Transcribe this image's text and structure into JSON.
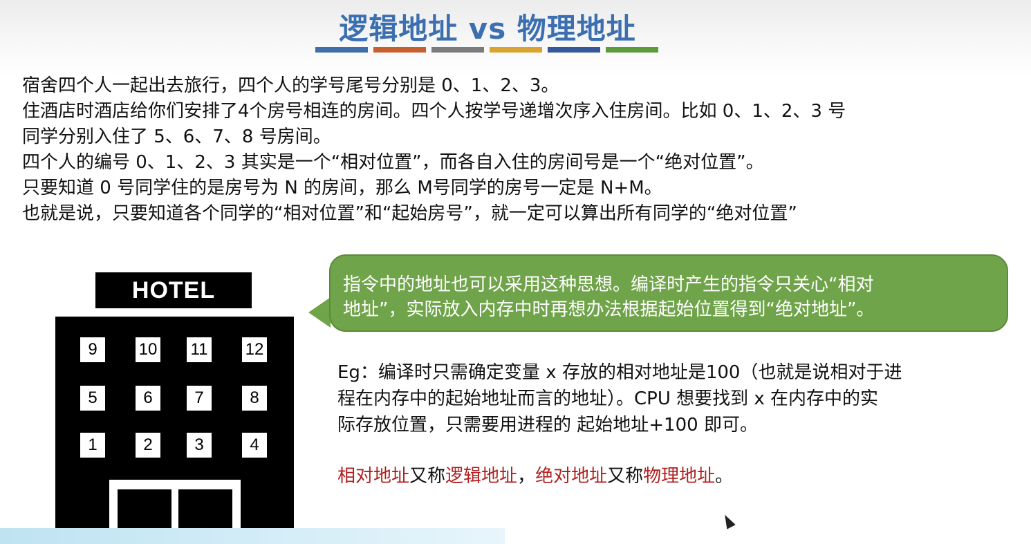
{
  "slide": {
    "title": "逻辑地址 vs 物理地址",
    "stripe_colors": [
      "#3f6fa8",
      "#c6602f",
      "#7b7b7b",
      "#d9a330",
      "#34589a",
      "#5c9a3c"
    ],
    "paragraph_lines": [
      "宿舍四个人一起出去旅行，四个人的学号尾号分别是 0、1、2、3。",
      "住酒店时酒店给你们安排了4个房号相连的房间。四个人按学号递增次序入住房间。比如 0、1、2、3 号",
      "同学分别入住了 5、6、7、8 号房间。",
      "四个人的编号 0、1、2、3 其实是一个“相对位置”，而各自入住的房间号是一个“绝对位置”。",
      "只要知道 0 号同学住的是房号为 N 的房间，那么 M号同学的房号一定是 N+M。",
      "也就是说，只要知道各个同学的“相对位置”和“起始房号”，就一定可以算出所有同学的“绝对位置”"
    ],
    "hotel": {
      "sign": "HOTEL",
      "rooms_row1": [
        "9",
        "10",
        "11",
        "12"
      ],
      "rooms_row2": [
        "5",
        "6",
        "7",
        "8"
      ],
      "rooms_row3": [
        "1",
        "2",
        "3",
        "4"
      ]
    },
    "bubble_lines": [
      "指令中的地址也可以采用这种思想。编译时产生的指令只关心“相对",
      "地址”，实际放入内存中时再想办法根据起始位置得到“绝对地址”。"
    ],
    "eg_lines": [
      "Eg：编译时只需确定变量 x 存放的相对地址是100（也就是说相对于进",
      "程在内存中的起始地址而言的地址）。CPU 想要找到 x 在内存中的实",
      "际存放位置，只需要用进程的 起始地址+100 即可。"
    ],
    "summary": {
      "part1": "相对地址",
      "part2": "又称",
      "part3": "逻辑地址",
      "part4": "，",
      "part5": "绝对地址",
      "part6": "又称",
      "part7": "物理地址",
      "part8": "。"
    }
  }
}
